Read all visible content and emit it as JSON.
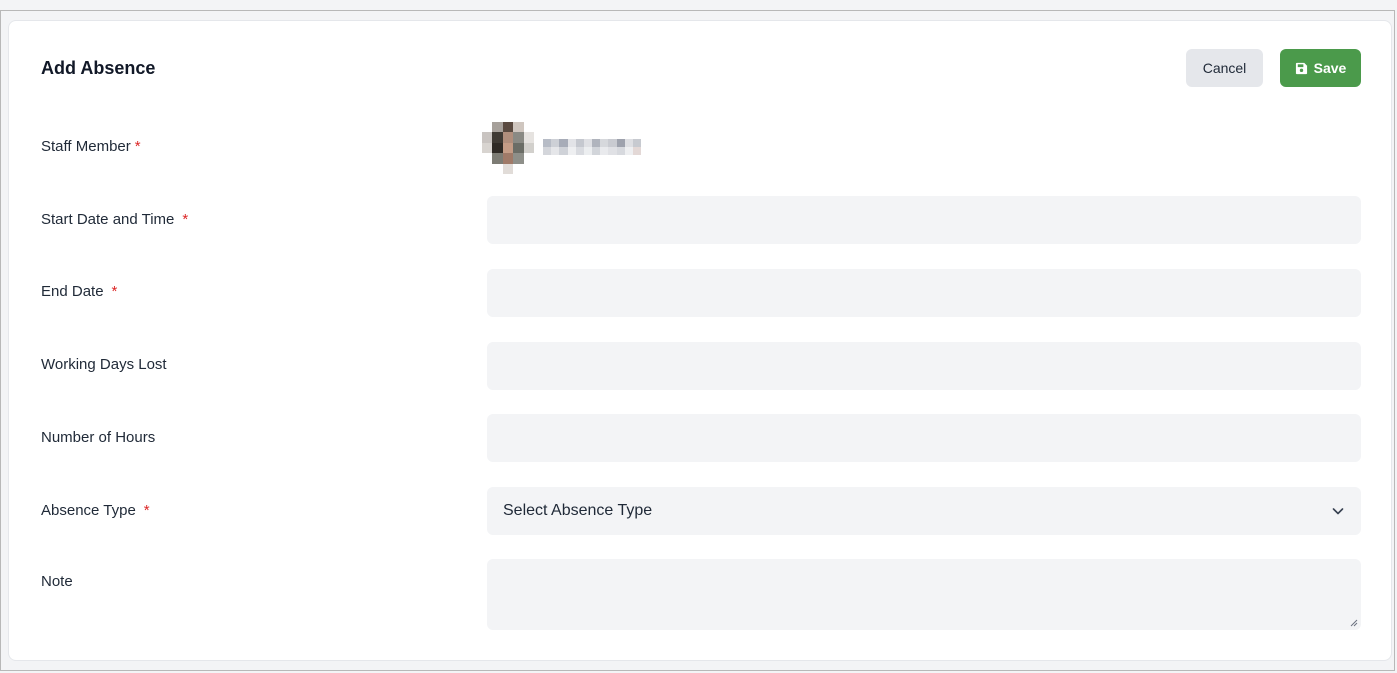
{
  "form": {
    "title": "Add Absence",
    "cancel_label": "Cancel",
    "save_label": "Save",
    "colors": {
      "save": "#4b9a4b",
      "required": "#dc2626",
      "field_bg": "#f3f4f6"
    }
  },
  "fields": {
    "staff_member": {
      "label": "Staff Member",
      "required_mark": "*"
    },
    "start_date": {
      "label": "Start Date and Time",
      "required_mark": "*",
      "value": ""
    },
    "end_date": {
      "label": "End Date",
      "required_mark": "*",
      "value": ""
    },
    "working_days_lost": {
      "label": "Working Days Lost",
      "value": ""
    },
    "number_of_hours": {
      "label": "Number of Hours",
      "value": ""
    },
    "absence_type": {
      "label": "Absence Type",
      "required_mark": "*",
      "selected": "Select Absence Type"
    },
    "note": {
      "label": "Note",
      "value": ""
    }
  },
  "icons": {
    "save": "floppy-disk-icon",
    "dropdown": "chevron-down-icon"
  }
}
